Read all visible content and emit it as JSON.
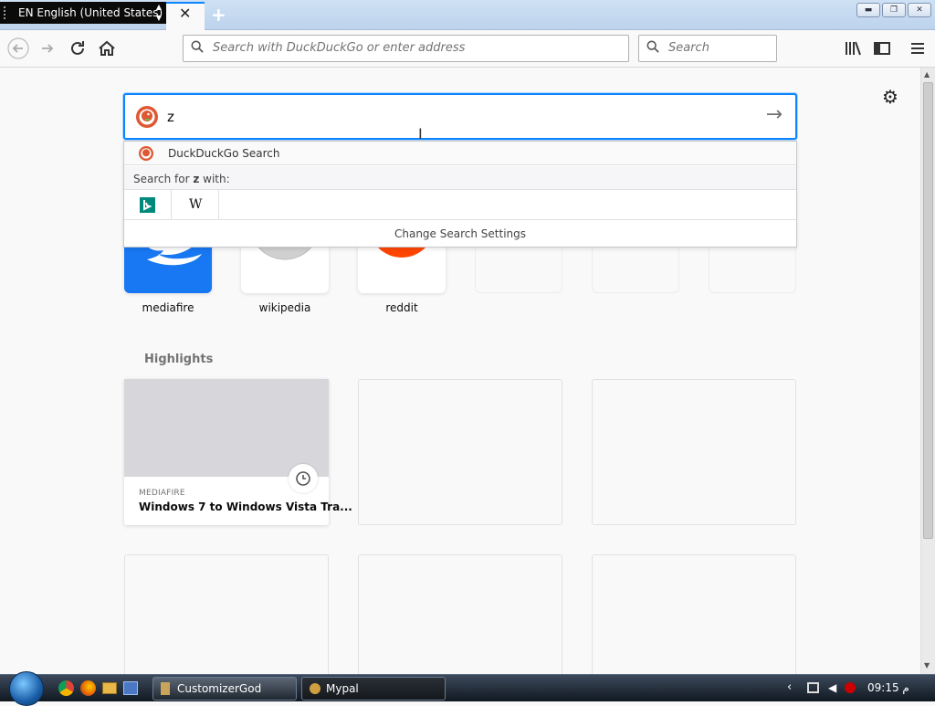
{
  "tabstrip": {
    "language": "EN English (United States)",
    "close_glyph": "✕",
    "newtab_glyph": "+"
  },
  "navbar": {
    "url_placeholder": "Search with DuckDuckGo or enter address",
    "search_placeholder": "Search"
  },
  "search": {
    "value": "z",
    "suggestion": "DuckDuckGo Search",
    "search_for_prefix": "Search for ",
    "search_for_term": "z",
    "search_for_suffix": " with:",
    "change_settings": "Change Search Settings",
    "engines": [
      "bing-icon",
      "wikipedia-icon"
    ],
    "wiki_letter": "W"
  },
  "top_sites": [
    {
      "label": "mediafire"
    },
    {
      "label": "wikipedia"
    },
    {
      "label": "reddit"
    }
  ],
  "highlights": {
    "title": "Highlights",
    "cards": [
      {
        "source": "MEDIAFIRE",
        "title": "Windows 7 to Windows Vista Tra..."
      }
    ]
  },
  "taskbar": {
    "items": [
      "CustomizerGod",
      "Mypal"
    ],
    "clock": "09:15 م"
  },
  "colors": {
    "accent": "#0a84ff",
    "ddg_orange": "#de5833",
    "reddit_orange": "#ff4500",
    "mediafire_blue": "#1877f2",
    "bing_teal": "#00897b"
  }
}
